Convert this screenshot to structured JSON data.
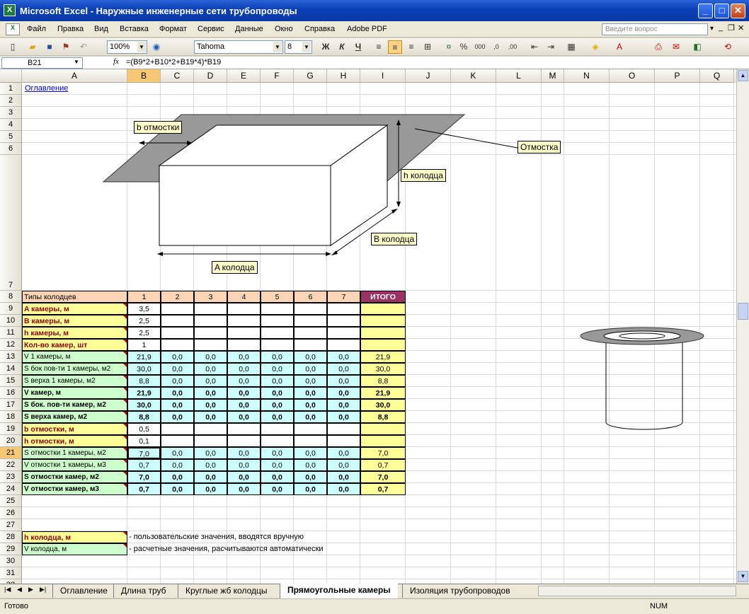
{
  "window": {
    "title": "Microsoft Excel - Наружные инженерные сети трубопроводы",
    "app_icon": "excel-icon",
    "minimize": "_",
    "maximize": "□",
    "close": "✕"
  },
  "menu": {
    "items": [
      "Файл",
      "Правка",
      "Вид",
      "Вставка",
      "Формат",
      "Сервис",
      "Данные",
      "Окно",
      "Справка",
      "Adobe PDF"
    ],
    "ask_placeholder": "Введите вопрос"
  },
  "toolbar": {
    "zoom": "100%",
    "font": "Tahoma",
    "font_size": "8",
    "bold": "Ж",
    "italic": "К",
    "underline": "Ч",
    "percent": "%",
    "thousands": "000",
    "inc_dec": ",0",
    "dec_dec": ",00"
  },
  "formula_bar": {
    "name_box": "B21",
    "fx": "fx",
    "formula": "=(B9*2+B10*2+B19*4)*B19"
  },
  "columns": [
    "A",
    "B",
    "C",
    "D",
    "E",
    "F",
    "G",
    "H",
    "I",
    "J",
    "K",
    "L",
    "M",
    "N",
    "O",
    "P",
    "Q"
  ],
  "rows": [
    "1",
    "2",
    "3",
    "4",
    "5",
    "6",
    "7",
    "8",
    "9",
    "10",
    "11",
    "12",
    "13",
    "14",
    "15",
    "16",
    "17",
    "18",
    "19",
    "20",
    "21",
    "22",
    "23",
    "24",
    "25",
    "26",
    "27",
    "28",
    "29",
    "30",
    "31",
    "32"
  ],
  "sheet": {
    "link": "Оглавление",
    "callouts": {
      "b_otm": "b отмостки",
      "otmostka": "Отмостка",
      "h_kol": "h колодца",
      "b_kol": "B колодца",
      "a_kol": "A колодца"
    },
    "header": {
      "label": "Типы колодцев",
      "types": [
        "1",
        "2",
        "3",
        "4",
        "5",
        "6",
        "7"
      ],
      "total": "ИТОГО"
    },
    "input_rows": [
      {
        "label": "A камеры, м",
        "v": "3,5"
      },
      {
        "label": "B камеры, м",
        "v": "2,5"
      },
      {
        "label": "h камеры, м",
        "v": "2,5"
      },
      {
        "label": "Кол-во камер, шт",
        "v": "1"
      }
    ],
    "calc_rows": [
      {
        "label": "V 1 камеры, м",
        "vals": [
          "21,9",
          "0,0",
          "0,0",
          "0,0",
          "0,0",
          "0,0",
          "0,0"
        ],
        "total": "21,9",
        "bold": false
      },
      {
        "label": "S бок пов-ти 1 камеры, м2",
        "vals": [
          "30,0",
          "0,0",
          "0,0",
          "0,0",
          "0,0",
          "0,0",
          "0,0"
        ],
        "total": "30,0",
        "bold": false
      },
      {
        "label": "S верха 1 камеры, м2",
        "vals": [
          "8,8",
          "0,0",
          "0,0",
          "0,0",
          "0,0",
          "0,0",
          "0,0"
        ],
        "total": "8,8",
        "bold": false
      },
      {
        "label": "V камер, м",
        "vals": [
          "21,9",
          "0,0",
          "0,0",
          "0,0",
          "0,0",
          "0,0",
          "0,0"
        ],
        "total": "21,9",
        "bold": true
      },
      {
        "label": "S бок. пов-ти камер, м2",
        "vals": [
          "30,0",
          "0,0",
          "0,0",
          "0,0",
          "0,0",
          "0,0",
          "0,0"
        ],
        "total": "30,0",
        "bold": true
      },
      {
        "label": "S верха камер, м2",
        "vals": [
          "8,8",
          "0,0",
          "0,0",
          "0,0",
          "0,0",
          "0,0",
          "0,0"
        ],
        "total": "8,8",
        "bold": true
      }
    ],
    "input_rows2": [
      {
        "label": "b отмостки, м",
        "v": "0,5"
      },
      {
        "label": "h отмостки, м",
        "v": "0,1"
      }
    ],
    "calc_rows2": [
      {
        "label": "S отмостки 1 камеры, м2",
        "vals": [
          "7,0",
          "0,0",
          "0,0",
          "0,0",
          "0,0",
          "0,0",
          "0,0"
        ],
        "total": "7,0",
        "bold": false
      },
      {
        "label": "V отмостки 1 камеры, м3",
        "vals": [
          "0,7",
          "0,0",
          "0,0",
          "0,0",
          "0,0",
          "0,0",
          "0,0"
        ],
        "total": "0,7",
        "bold": false
      },
      {
        "label": "S отмостки камер, м2",
        "vals": [
          "7,0",
          "0,0",
          "0,0",
          "0,0",
          "0,0",
          "0,0",
          "0,0"
        ],
        "total": "7,0",
        "bold": true
      },
      {
        "label": "V отмостки камер, м3",
        "vals": [
          "0,7",
          "0,0",
          "0,0",
          "0,0",
          "0,0",
          "0,0",
          "0,0"
        ],
        "total": "0,7",
        "bold": true
      }
    ],
    "legend": [
      {
        "label": "h колодца, м",
        "text": "- пользовательские значения, вводятся вручную"
      },
      {
        "label": "V колодца, м",
        "text": "- расчетные значения, расчитываются автоматически"
      }
    ]
  },
  "tabs": {
    "items": [
      "Оглавление",
      "Длина труб",
      "Круглые жб колодцы",
      "Прямоугольные камеры",
      "Изоляция трубопроводов"
    ],
    "active": "Прямоугольные камеры"
  },
  "status": {
    "left": "Готово",
    "num": "NUM"
  }
}
